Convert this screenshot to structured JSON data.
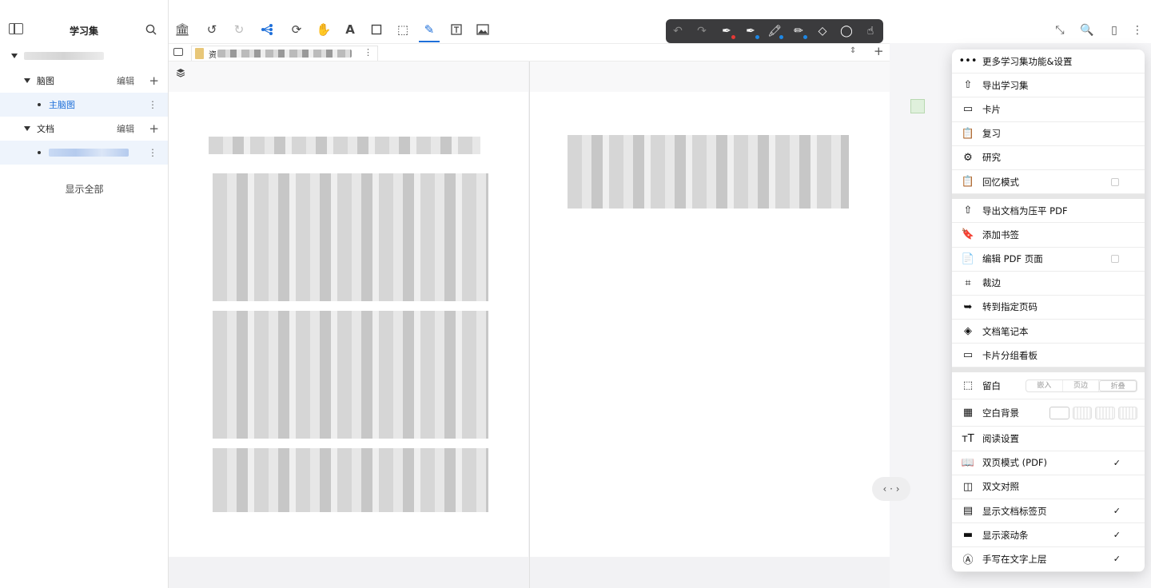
{
  "sidebar": {
    "title": "学习集",
    "mindmap_group": {
      "label": "脑图",
      "edit": "编辑"
    },
    "mindmap_item": "主脑图",
    "doc_group": {
      "label": "文档",
      "edit": "编辑"
    },
    "show_all": "显示全部"
  },
  "tab": {
    "label": "资"
  },
  "nav_pill": "‹ · ›",
  "menu": {
    "items": [
      {
        "label": "更多学习集功能&设置",
        "icon": "more-dots-icon"
      },
      {
        "label": "导出学习集",
        "icon": "share-icon"
      },
      {
        "label": "卡片",
        "icon": "cards-icon"
      },
      {
        "label": "复习",
        "icon": "clipboard-icon"
      },
      {
        "label": "研究",
        "icon": "research-icon"
      },
      {
        "label": "回忆模式",
        "icon": "recall-icon",
        "checkbox": false
      }
    ],
    "items2": [
      {
        "label": "导出文档为压平 PDF",
        "icon": "share-icon"
      },
      {
        "label": "添加书签",
        "icon": "bookmark-icon"
      },
      {
        "label": "编辑 PDF 页面",
        "icon": "edit-pdf-icon",
        "checkbox": false
      },
      {
        "label": "裁边",
        "icon": "crop-icon"
      },
      {
        "label": "转到指定页码",
        "icon": "goto-page-icon"
      },
      {
        "label": "文档笔记本",
        "icon": "layers-icon"
      },
      {
        "label": "卡片分组看板",
        "icon": "board-icon"
      }
    ],
    "margin": {
      "label": "留白",
      "options": [
        "嵌入",
        "页边",
        "折叠"
      ],
      "selected": "折叠"
    },
    "blank_bg": {
      "label": "空白背景"
    },
    "items3": [
      {
        "label": "阅读设置",
        "icon": "text-size-icon"
      },
      {
        "label": "双页模式 (PDF)",
        "icon": "book-icon",
        "checked": true
      },
      {
        "label": "双文对照",
        "icon": "split-icon"
      },
      {
        "label": "显示文档标签页",
        "icon": "tabs-icon",
        "checked": true
      },
      {
        "label": "显示滚动条",
        "icon": "scrollbar-icon",
        "checked": true
      },
      {
        "label": "手写在文字上层",
        "icon": "handwrite-icon",
        "checked": true
      }
    ]
  },
  "checkmark": "✓"
}
